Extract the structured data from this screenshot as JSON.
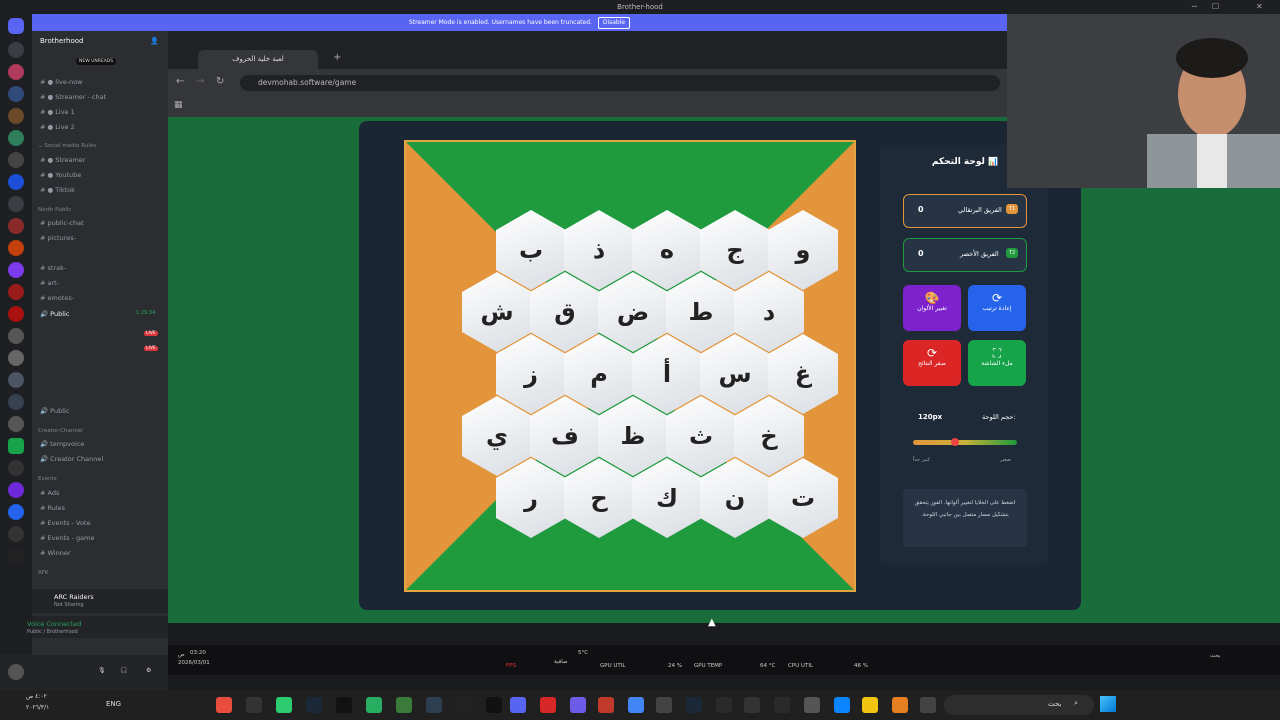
{
  "titlebar": {
    "title": "Brother-hood"
  },
  "banner": {
    "text": "Streamer Mode is enabled. Usernames have been truncated.",
    "button": "Disable"
  },
  "discord": {
    "server_name": "Brotherhood",
    "new_unreads": "NEW UNREADS",
    "channels": [
      {
        "name": "live-now"
      },
      {
        "name": "Streamer - chat"
      },
      {
        "name": "Live 1"
      },
      {
        "name": "Live 2"
      },
      {
        "name": "Streamer"
      },
      {
        "name": "Youtube"
      },
      {
        "name": "Tiktok"
      },
      {
        "name": "public-chat"
      },
      {
        "name": "pictures-"
      },
      {
        "name": "strak-"
      },
      {
        "name": "art-"
      },
      {
        "name": "emotes-"
      },
      {
        "name": "Public"
      },
      {
        "name": "Public"
      },
      {
        "name": "tempvoice"
      },
      {
        "name": "Creator Channel"
      },
      {
        "name": "Ads"
      },
      {
        "name": "Rules"
      },
      {
        "name": "Events - Vote"
      },
      {
        "name": "Events - game"
      },
      {
        "name": "Winner"
      }
    ],
    "categories": [
      "Social media",
      "Social media Rules",
      "North Public",
      "Creator-Channel",
      "Events",
      "AFK"
    ],
    "voice_timer": "1:29:34",
    "live_label": "LIVE",
    "game": {
      "title": "ARC Raiders",
      "subtitle": "Not Sharing"
    },
    "voice": {
      "status": "Voice Connected",
      "channel": "Public / Brotherhood"
    }
  },
  "browser": {
    "tab_title": "لعبة خلية الحروف",
    "url": "devmohab.software/game"
  },
  "board": {
    "rows": [
      [
        "ب",
        "ذ",
        "ه",
        "ج",
        "و"
      ],
      [
        "ش",
        "ق",
        "ض",
        "ط",
        "د"
      ],
      [
        "ز",
        "م",
        "أ",
        "س",
        "غ"
      ],
      [
        "ي",
        "ف",
        "ظ",
        "ث",
        "خ"
      ],
      [
        "ر",
        "ح",
        "ك",
        "ن",
        "ت"
      ]
    ]
  },
  "control": {
    "title": "لوحة التحكم",
    "team_orange": {
      "name": "الفريق البرتقالي",
      "score": "0",
      "badge": "T1"
    },
    "team_green": {
      "name": "الفريق الأخضر",
      "score": "0",
      "badge": "T2"
    },
    "btn_reorder": "إعادة ترتيب",
    "btn_colors": "تغيير الألوان",
    "btn_fullscreen": "ملء الشاشة",
    "btn_reset": "صفر النتائج",
    "size_label": "حجم اللوحة:",
    "size_value": "120px",
    "slider_min": "صغير",
    "slider_max": "كبير جداً",
    "slider_value": 0.4,
    "hint": "اضغط على الخلايا لتغيير ألوانها. الفوز يتحقق بتشكيل مسار متصل بين جانبي اللوحة."
  },
  "overlay": {
    "time": "03:20",
    "date": "2026/03/01",
    "ampm": "ص",
    "weather": "5°C",
    "weather_sub": "صافية",
    "fps": "FPS",
    "gpu_util": "GPU UTIL",
    "gpu_util_val": "24 %",
    "gpu_temp": "GPU TEMP",
    "gpu_temp_val": "64 °C",
    "cpu_util": "CPU UTIL",
    "cpu_util_val": "46 %",
    "search": "بحث"
  },
  "taskbar": {
    "lang": "ENG",
    "search": "بحث",
    "clock": "٤:٠٢ ص",
    "date": "٢٠٢٦/٣/١"
  },
  "colors": {
    "board_green": "#1f9a3d",
    "board_orange": "#e2953a",
    "panel": "#1a2634",
    "discord_bg": "#2b2d31",
    "accent": "#5865f2"
  }
}
